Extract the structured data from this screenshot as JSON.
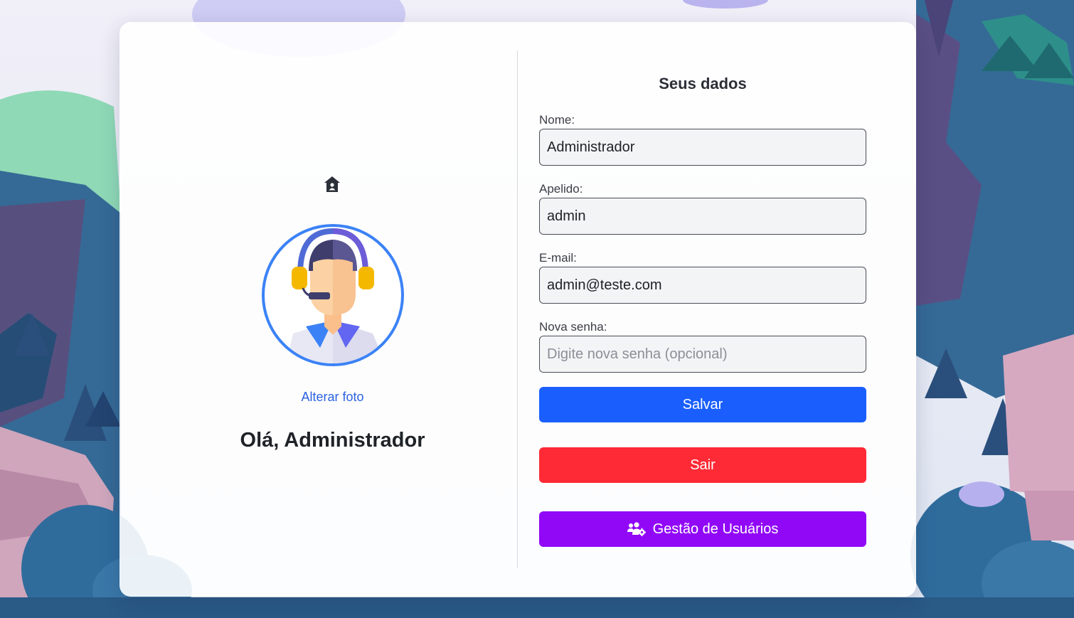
{
  "profile": {
    "change_photo_label": "Alterar foto",
    "greeting": "Olá, Administrador"
  },
  "form": {
    "title": "Seus dados",
    "name_label": "Nome:",
    "name_value": "Administrador",
    "nickname_label": "Apelido:",
    "nickname_value": "admin",
    "email_label": "E-mail:",
    "email_value": "admin@teste.com",
    "password_label": "Nova senha:",
    "password_placeholder": "Digite nova senha (opcional)",
    "save_label": "Salvar",
    "exit_label": "Sair",
    "users_label": "Gestão de Usuários"
  },
  "icons": {
    "home": "home-icon",
    "avatar": "support-agent-avatar",
    "users": "users-gear-icon"
  },
  "colors": {
    "save": "#1a5ffe",
    "exit": "#fe2a35",
    "users": "#9108f7",
    "link": "#2b62e0",
    "avatar_ring": "#3b82f6"
  }
}
